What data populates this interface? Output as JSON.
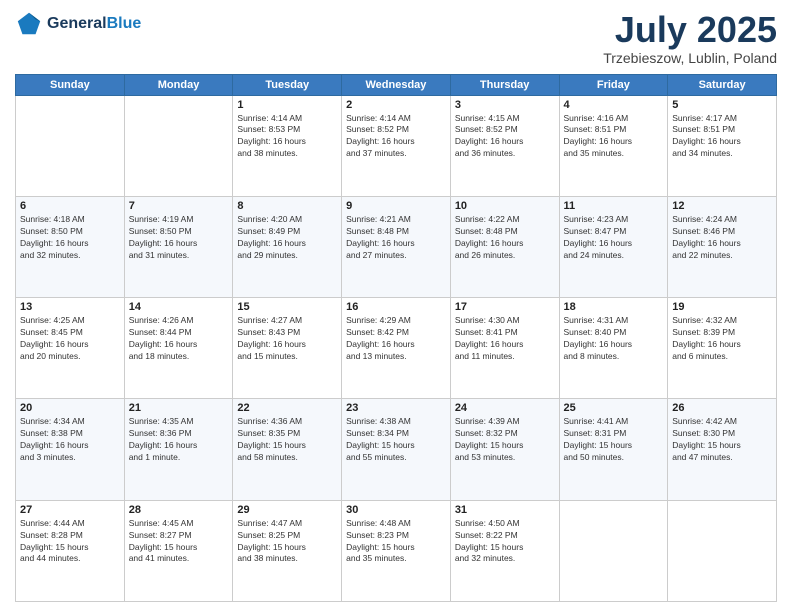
{
  "header": {
    "logo_line1": "General",
    "logo_line2": "Blue",
    "title": "July 2025",
    "subtitle": "Trzebieszow, Lublin, Poland"
  },
  "days_of_week": [
    "Sunday",
    "Monday",
    "Tuesday",
    "Wednesday",
    "Thursday",
    "Friday",
    "Saturday"
  ],
  "weeks": [
    [
      {
        "day": "",
        "info": ""
      },
      {
        "day": "",
        "info": ""
      },
      {
        "day": "1",
        "info": "Sunrise: 4:14 AM\nSunset: 8:53 PM\nDaylight: 16 hours\nand 38 minutes."
      },
      {
        "day": "2",
        "info": "Sunrise: 4:14 AM\nSunset: 8:52 PM\nDaylight: 16 hours\nand 37 minutes."
      },
      {
        "day": "3",
        "info": "Sunrise: 4:15 AM\nSunset: 8:52 PM\nDaylight: 16 hours\nand 36 minutes."
      },
      {
        "day": "4",
        "info": "Sunrise: 4:16 AM\nSunset: 8:51 PM\nDaylight: 16 hours\nand 35 minutes."
      },
      {
        "day": "5",
        "info": "Sunrise: 4:17 AM\nSunset: 8:51 PM\nDaylight: 16 hours\nand 34 minutes."
      }
    ],
    [
      {
        "day": "6",
        "info": "Sunrise: 4:18 AM\nSunset: 8:50 PM\nDaylight: 16 hours\nand 32 minutes."
      },
      {
        "day": "7",
        "info": "Sunrise: 4:19 AM\nSunset: 8:50 PM\nDaylight: 16 hours\nand 31 minutes."
      },
      {
        "day": "8",
        "info": "Sunrise: 4:20 AM\nSunset: 8:49 PM\nDaylight: 16 hours\nand 29 minutes."
      },
      {
        "day": "9",
        "info": "Sunrise: 4:21 AM\nSunset: 8:48 PM\nDaylight: 16 hours\nand 27 minutes."
      },
      {
        "day": "10",
        "info": "Sunrise: 4:22 AM\nSunset: 8:48 PM\nDaylight: 16 hours\nand 26 minutes."
      },
      {
        "day": "11",
        "info": "Sunrise: 4:23 AM\nSunset: 8:47 PM\nDaylight: 16 hours\nand 24 minutes."
      },
      {
        "day": "12",
        "info": "Sunrise: 4:24 AM\nSunset: 8:46 PM\nDaylight: 16 hours\nand 22 minutes."
      }
    ],
    [
      {
        "day": "13",
        "info": "Sunrise: 4:25 AM\nSunset: 8:45 PM\nDaylight: 16 hours\nand 20 minutes."
      },
      {
        "day": "14",
        "info": "Sunrise: 4:26 AM\nSunset: 8:44 PM\nDaylight: 16 hours\nand 18 minutes."
      },
      {
        "day": "15",
        "info": "Sunrise: 4:27 AM\nSunset: 8:43 PM\nDaylight: 16 hours\nand 15 minutes."
      },
      {
        "day": "16",
        "info": "Sunrise: 4:29 AM\nSunset: 8:42 PM\nDaylight: 16 hours\nand 13 minutes."
      },
      {
        "day": "17",
        "info": "Sunrise: 4:30 AM\nSunset: 8:41 PM\nDaylight: 16 hours\nand 11 minutes."
      },
      {
        "day": "18",
        "info": "Sunrise: 4:31 AM\nSunset: 8:40 PM\nDaylight: 16 hours\nand 8 minutes."
      },
      {
        "day": "19",
        "info": "Sunrise: 4:32 AM\nSunset: 8:39 PM\nDaylight: 16 hours\nand 6 minutes."
      }
    ],
    [
      {
        "day": "20",
        "info": "Sunrise: 4:34 AM\nSunset: 8:38 PM\nDaylight: 16 hours\nand 3 minutes."
      },
      {
        "day": "21",
        "info": "Sunrise: 4:35 AM\nSunset: 8:36 PM\nDaylight: 16 hours\nand 1 minute."
      },
      {
        "day": "22",
        "info": "Sunrise: 4:36 AM\nSunset: 8:35 PM\nDaylight: 15 hours\nand 58 minutes."
      },
      {
        "day": "23",
        "info": "Sunrise: 4:38 AM\nSunset: 8:34 PM\nDaylight: 15 hours\nand 55 minutes."
      },
      {
        "day": "24",
        "info": "Sunrise: 4:39 AM\nSunset: 8:32 PM\nDaylight: 15 hours\nand 53 minutes."
      },
      {
        "day": "25",
        "info": "Sunrise: 4:41 AM\nSunset: 8:31 PM\nDaylight: 15 hours\nand 50 minutes."
      },
      {
        "day": "26",
        "info": "Sunrise: 4:42 AM\nSunset: 8:30 PM\nDaylight: 15 hours\nand 47 minutes."
      }
    ],
    [
      {
        "day": "27",
        "info": "Sunrise: 4:44 AM\nSunset: 8:28 PM\nDaylight: 15 hours\nand 44 minutes."
      },
      {
        "day": "28",
        "info": "Sunrise: 4:45 AM\nSunset: 8:27 PM\nDaylight: 15 hours\nand 41 minutes."
      },
      {
        "day": "29",
        "info": "Sunrise: 4:47 AM\nSunset: 8:25 PM\nDaylight: 15 hours\nand 38 minutes."
      },
      {
        "day": "30",
        "info": "Sunrise: 4:48 AM\nSunset: 8:23 PM\nDaylight: 15 hours\nand 35 minutes."
      },
      {
        "day": "31",
        "info": "Sunrise: 4:50 AM\nSunset: 8:22 PM\nDaylight: 15 hours\nand 32 minutes."
      },
      {
        "day": "",
        "info": ""
      },
      {
        "day": "",
        "info": ""
      }
    ]
  ]
}
